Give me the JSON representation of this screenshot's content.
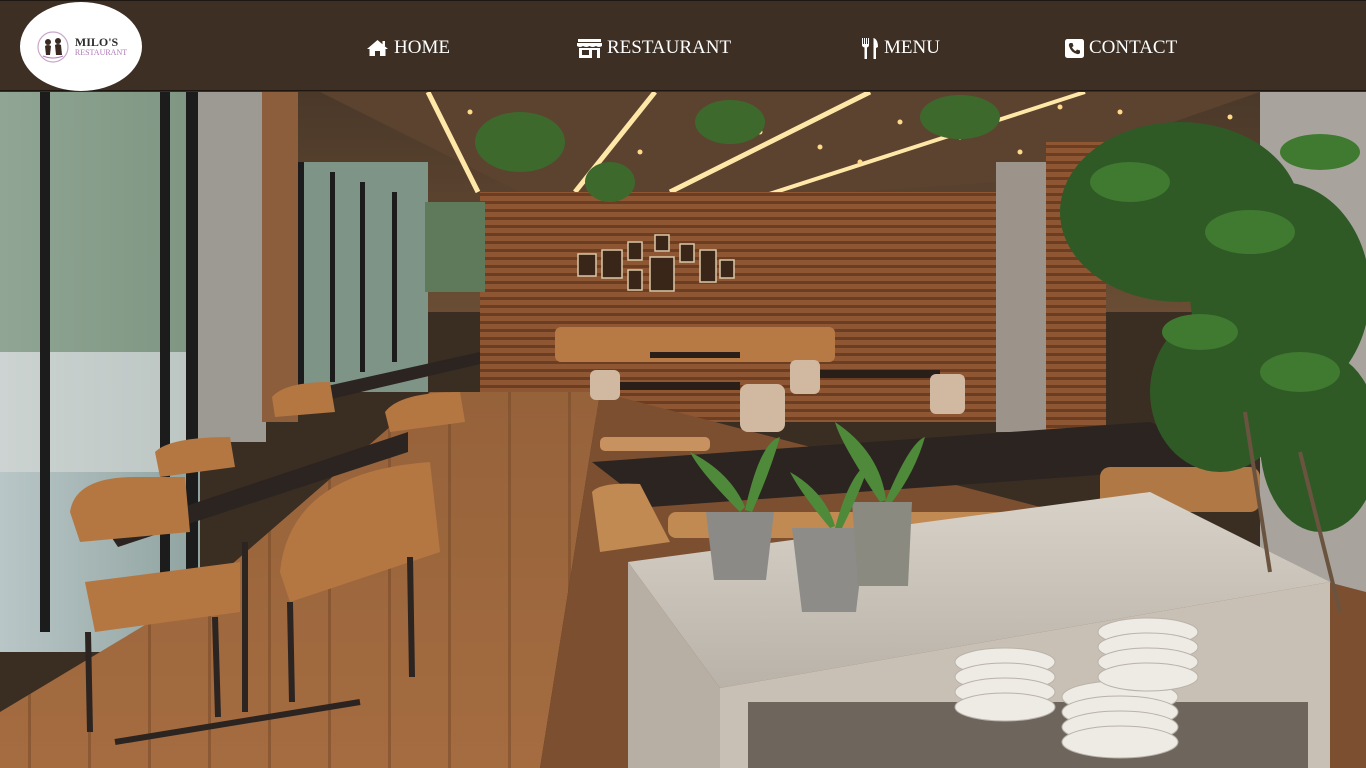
{
  "logo": {
    "name": "MILO'S",
    "subtitle": "RESTAURANT",
    "icon": "restaurant-logo-mark"
  },
  "nav": {
    "items": [
      {
        "label": "HOME",
        "icon": "home-icon"
      },
      {
        "label": "RESTAURANT",
        "icon": "storefront-icon"
      },
      {
        "label": "MENU",
        "icon": "utensils-icon"
      },
      {
        "label": "CONTACT",
        "icon": "phone-square-icon"
      }
    ]
  },
  "hero": {
    "subject": "restaurant-interior-photo"
  },
  "colors": {
    "header_bg": "#3d2f24",
    "nav_text": "#ffffff",
    "logo_accent": "#b07ab8"
  }
}
